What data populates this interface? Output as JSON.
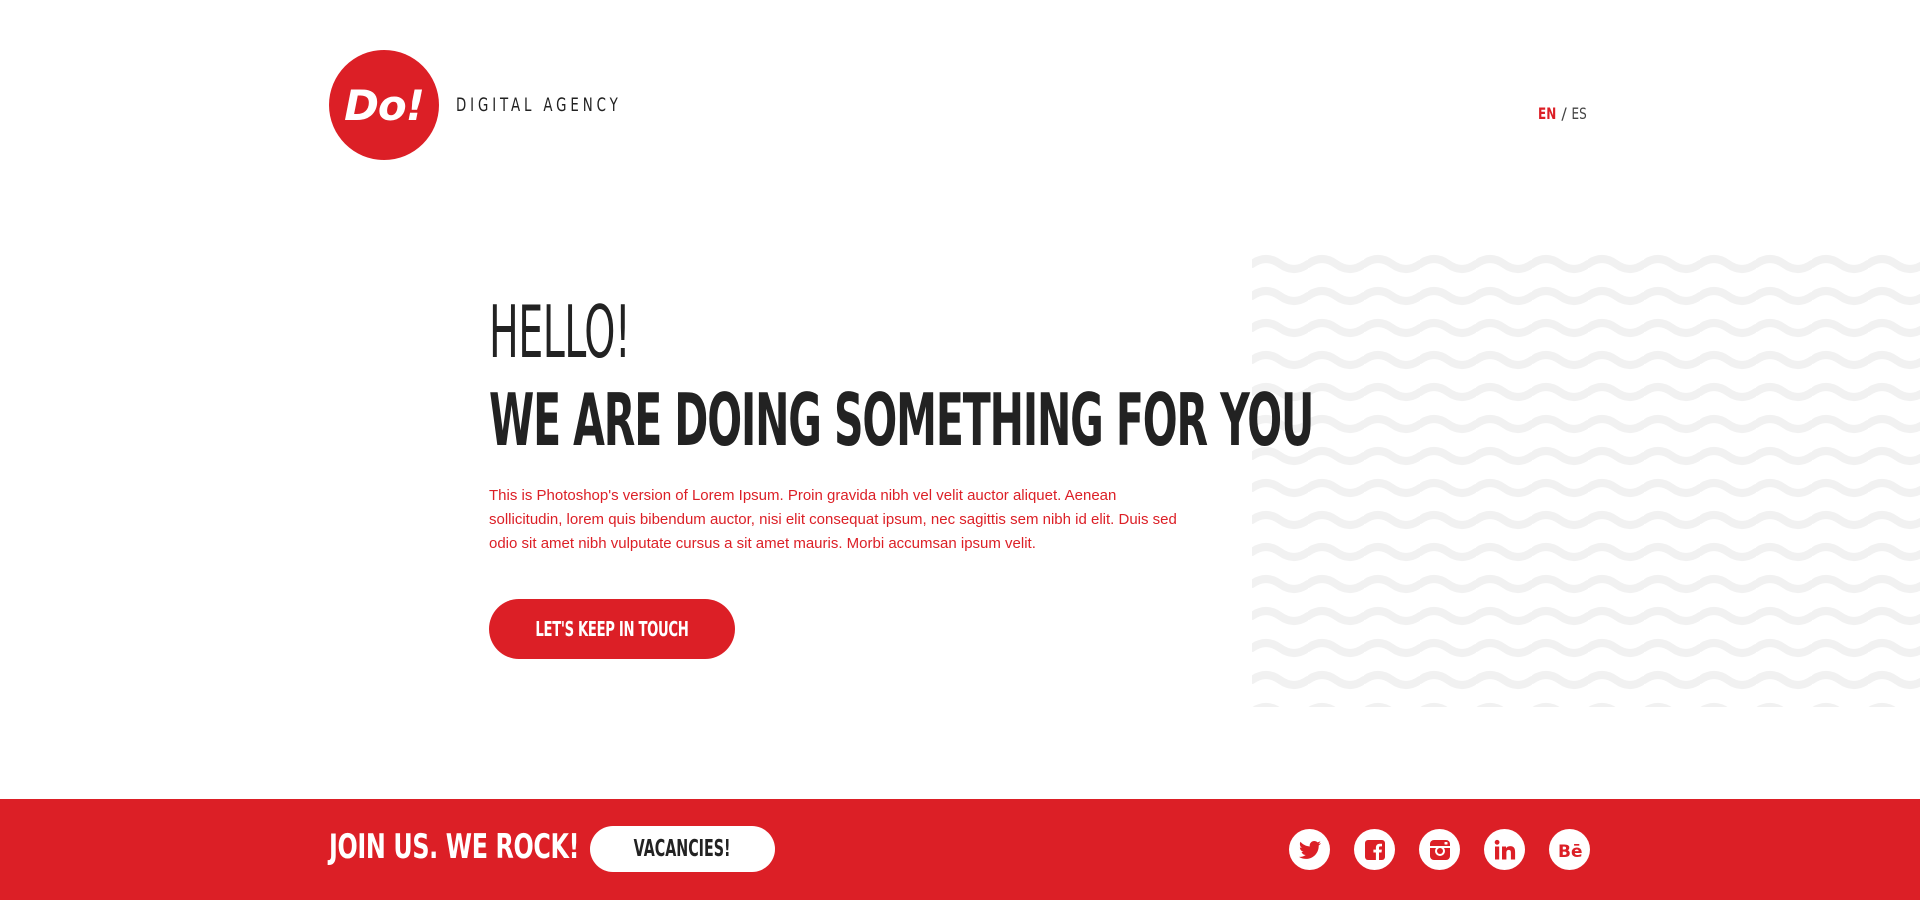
{
  "header": {
    "logo_text": "Do!",
    "tagline": "DIGITAL AGENCY",
    "lang": {
      "active": "EN",
      "separator": "/",
      "other": "ES"
    }
  },
  "hero": {
    "greeting": "HELLO!",
    "title": "WE ARE DOING SOMETHING FOR YOU",
    "body": "This is Photoshop's version  of Lorem Ipsum. Proin gravida nibh vel velit auctor aliquet. Aenean sollicitudin, lorem quis bibendum auctor, nisi elit consequat ipsum, nec sagittis sem nibh id elit. Duis sed odio sit amet nibh vulputate cursus a sit amet mauris. Morbi accumsan ipsum velit.",
    "cta_label": "LET'S KEEP IN TOUCH"
  },
  "footer": {
    "join_text": "JOIN US. WE ROCK!",
    "vacancies_label": "VACANCIES!",
    "socials": [
      "twitter-icon",
      "facebook-icon",
      "instagram-icon",
      "linkedin-icon",
      "behance-icon"
    ]
  },
  "colors": {
    "accent": "#dc1f26",
    "text": "#222222",
    "background": "#ffffff",
    "pattern": "#f2f2f2"
  }
}
